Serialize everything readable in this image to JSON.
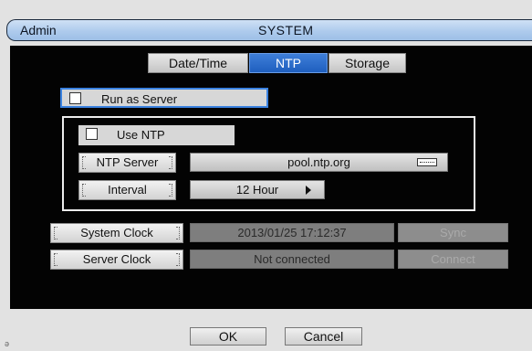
{
  "window": {
    "user": "Admin",
    "title": "SYSTEM"
  },
  "tabs": [
    {
      "label": "Date/Time",
      "active": false
    },
    {
      "label": "NTP",
      "active": true
    },
    {
      "label": "Storage",
      "active": false
    }
  ],
  "run_as_server": {
    "label": "Run as Server",
    "checked": false
  },
  "ntp": {
    "use_ntp": {
      "label": "Use NTP",
      "checked": false
    },
    "server_label": "NTP Server",
    "server_value": "pool.ntp.org",
    "interval_label": "Interval",
    "interval_value": "12 Hour"
  },
  "system_clock": {
    "label": "System Clock",
    "value": "2013/01/25  17:12:37",
    "action": "Sync"
  },
  "server_clock": {
    "label": "Server Clock",
    "value": "Not connected",
    "action": "Connect"
  },
  "buttons": {
    "ok": "OK",
    "cancel": "Cancel"
  },
  "footer": {
    "corner_glyph": "ə"
  },
  "colors": {
    "accent": "#2a6cd0",
    "title_bar": "#aecbed",
    "panel": "#030303"
  },
  "icons": {
    "keyboard": "keyboard-icon",
    "dropdown": "right-arrow-icon"
  }
}
